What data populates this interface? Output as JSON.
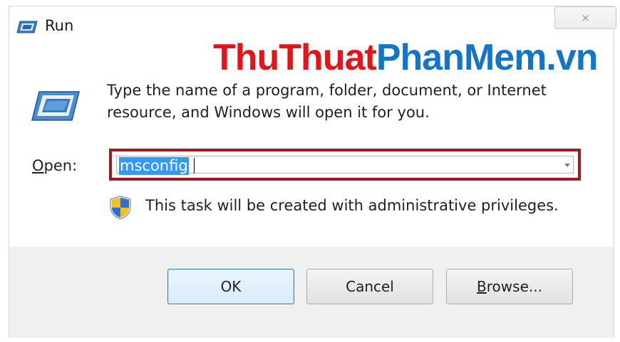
{
  "window": {
    "title": "Run",
    "close_symbol": "⨯"
  },
  "watermark": {
    "part1": "ThuThuat",
    "part2": "PhanMem.vn"
  },
  "prompt": {
    "line1": "Type the name of a program, folder, document, or Internet",
    "line2": "resource, and Windows will open it for you."
  },
  "open_field": {
    "label_accel": "O",
    "label_rest": "pen:",
    "value": "msconfig"
  },
  "admin_note": "This task will be created with administrative privileges.",
  "buttons": {
    "ok": "OK",
    "cancel": "Cancel",
    "browse_accel": "B",
    "browse_rest": "rowse..."
  },
  "colors": {
    "highlight_border": "#9e1b20",
    "selection": "#3399ff",
    "watermark_red": "#e5141b",
    "watermark_blue": "#1275c9"
  },
  "icons": [
    "run-icon",
    "shield-icon",
    "close-icon",
    "dropdown-arrow-icon"
  ]
}
